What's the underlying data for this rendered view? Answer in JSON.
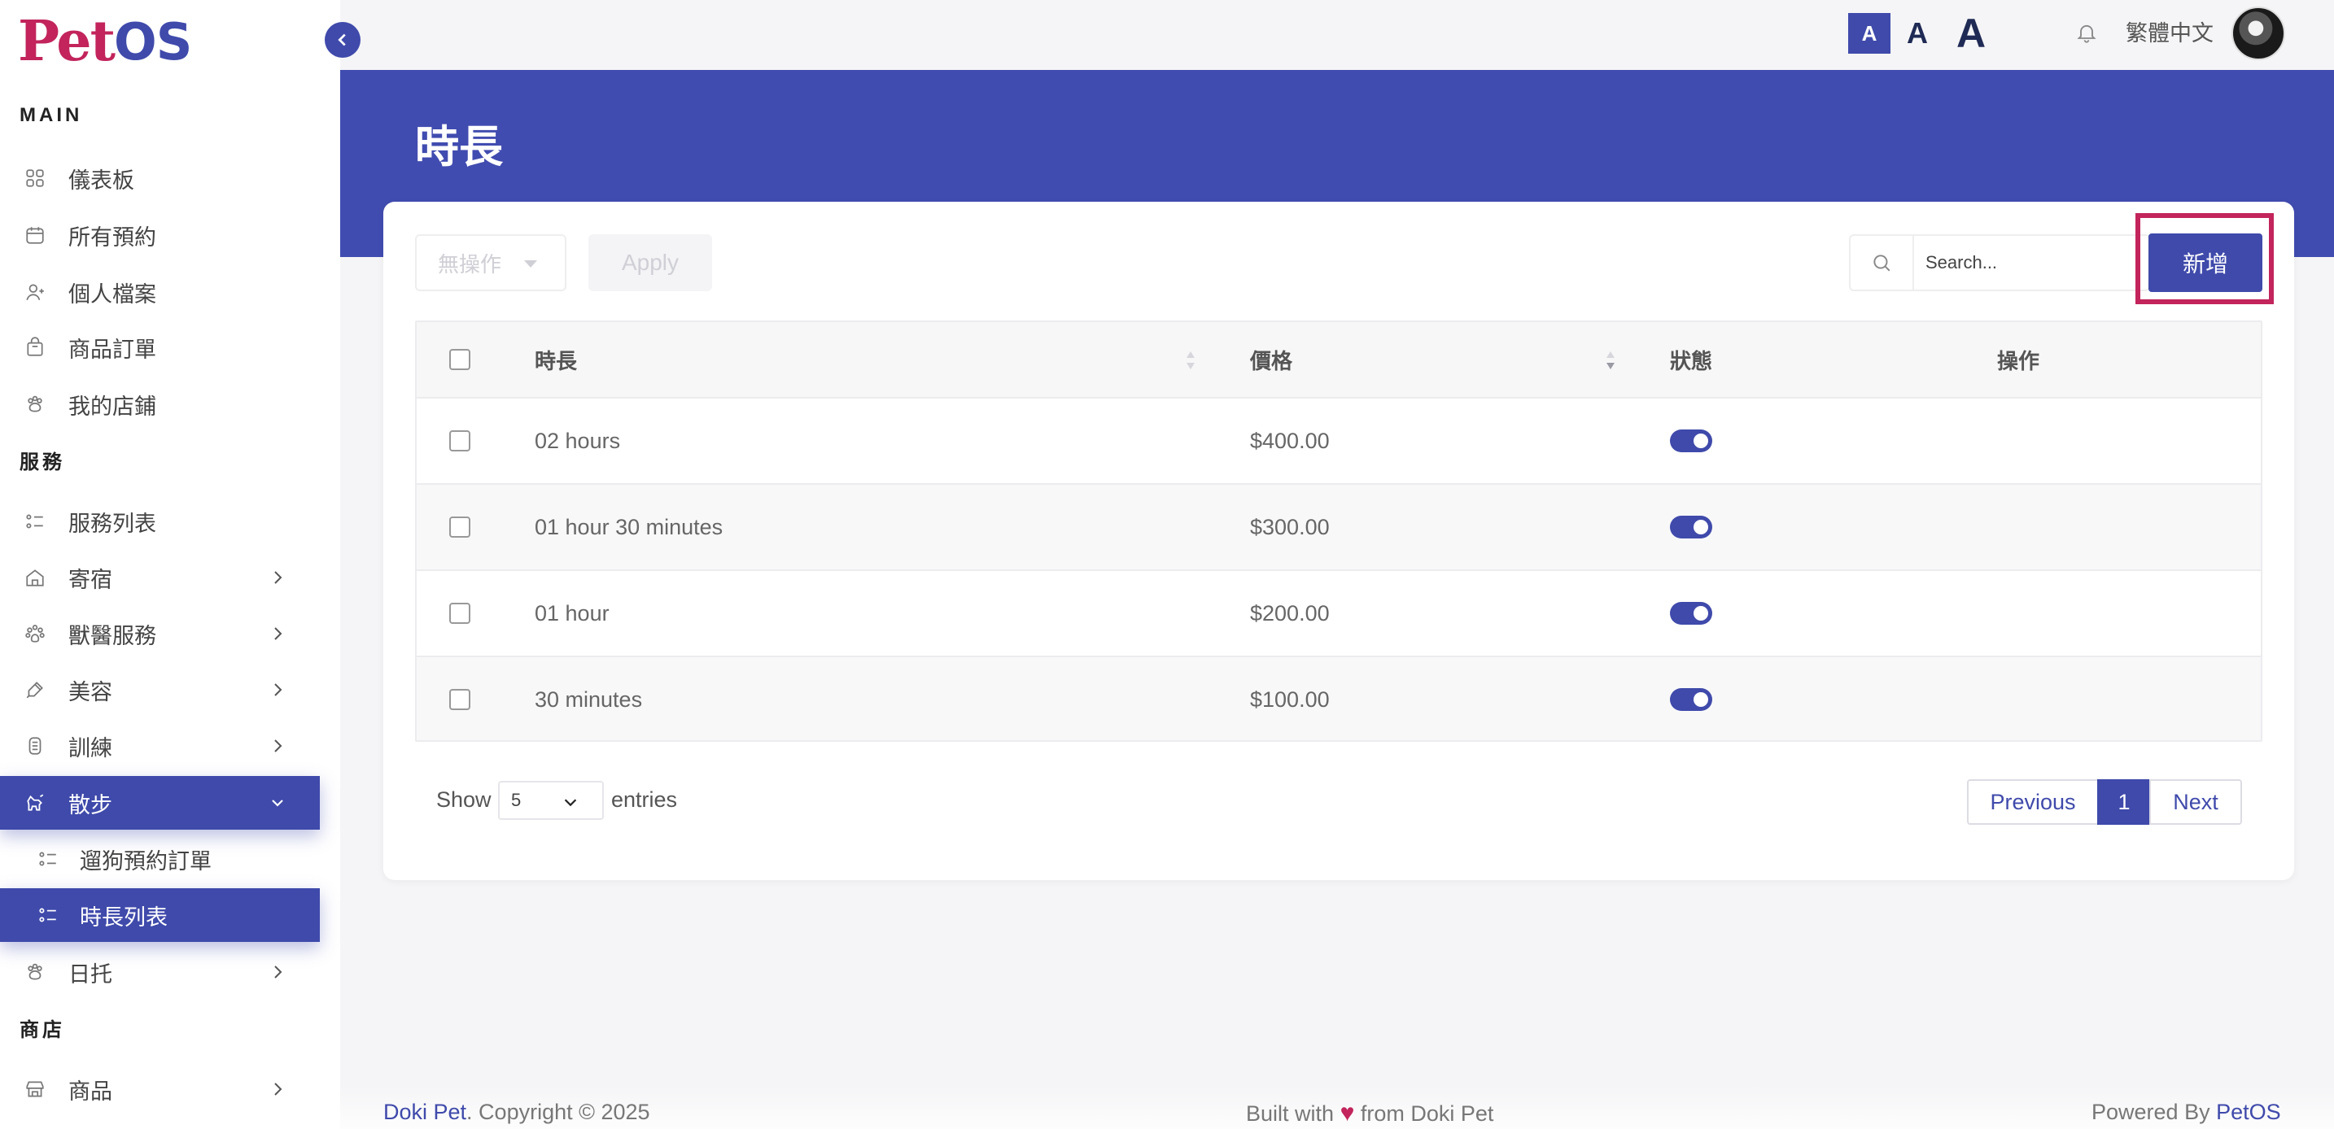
{
  "app": {
    "logo_part1": "Pet",
    "logo_part2": "OS"
  },
  "sidebar": {
    "sections": {
      "main": "MAIN",
      "services": "服務",
      "shop": "商店"
    },
    "items": [
      {
        "label": "儀表板",
        "icon": "grid-icon"
      },
      {
        "label": "所有預約",
        "icon": "calendar-icon"
      },
      {
        "label": "個人檔案",
        "icon": "user-icon"
      },
      {
        "label": "商品訂單",
        "icon": "bag-icon"
      },
      {
        "label": "我的店鋪",
        "icon": "paw-icon"
      },
      {
        "label": "服務列表",
        "icon": "list-icon"
      },
      {
        "label": "寄宿",
        "icon": "house-icon"
      },
      {
        "label": "獸醫服務",
        "icon": "vet-icon"
      },
      {
        "label": "美容",
        "icon": "brush-icon"
      },
      {
        "label": "訓練",
        "icon": "training-icon"
      },
      {
        "label": "散步",
        "icon": "dog-walk-icon"
      },
      {
        "label": "遛狗預約訂單",
        "icon": "list-icon"
      },
      {
        "label": "時長列表",
        "icon": "list-icon"
      },
      {
        "label": "日托",
        "icon": "daycare-icon"
      },
      {
        "label": "商品",
        "icon": "store-icon"
      }
    ]
  },
  "topbar": {
    "font_small": "A",
    "font_medium": "A",
    "font_large": "A",
    "language": "繁體中文"
  },
  "page": {
    "title": "時長"
  },
  "toolbar": {
    "bulk_action": "無操作",
    "apply": "Apply",
    "search_placeholder": "Search...",
    "add": "新增"
  },
  "table": {
    "headers": {
      "duration": "時長",
      "price": "價格",
      "status": "狀態",
      "actions": "操作"
    },
    "rows": [
      {
        "duration": "02 hours",
        "price": "$400.00",
        "status_on": true
      },
      {
        "duration": "01 hour 30 minutes",
        "price": "$300.00",
        "status_on": true
      },
      {
        "duration": "01 hour",
        "price": "$200.00",
        "status_on": true
      },
      {
        "duration": "30 minutes",
        "price": "$100.00",
        "status_on": true
      }
    ]
  },
  "pagination": {
    "show": "Show",
    "page_size": "5",
    "entries": "entries",
    "previous": "Previous",
    "current": "1",
    "next": "Next"
  },
  "footer": {
    "brand": "Doki Pet",
    "copyright": ". Copyright © 2025",
    "built_prefix": "Built with",
    "built_suffix": "from Doki Pet",
    "powered_prefix": "Powered By",
    "powered_brand": "PetOS"
  },
  "colors": {
    "primary": "#3f4aab",
    "accent": "#c2245b",
    "header": "#414cb0"
  }
}
